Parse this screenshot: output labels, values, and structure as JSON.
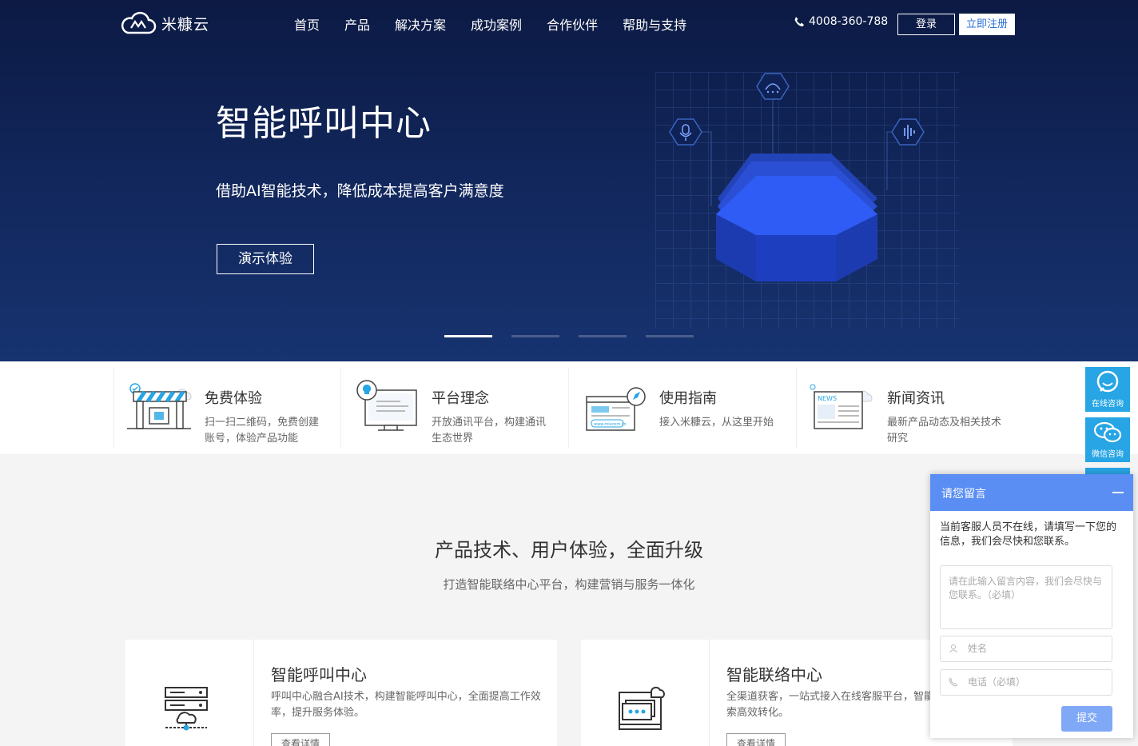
{
  "nav": {
    "logo_text": "米糠云",
    "items": [
      "首页",
      "产品",
      "解决方案",
      "成功案例",
      "合作伙伴",
      "帮助与支持"
    ],
    "phone": "4008-360-788",
    "login": "登录",
    "register": "立即注册"
  },
  "hero": {
    "title": "智能呼叫中心",
    "subtitle": "借助AI智能技术，降低成本提高客户满意度",
    "button": "演示体验",
    "active_slide": 1,
    "slide_count": 4
  },
  "features": [
    {
      "title": "免费体验",
      "desc": "扫一扫二维码，免费创建账号，体验产品功能",
      "icon": "store-icon"
    },
    {
      "title": "平台理念",
      "desc": "开放通讯平台，构建通讯生态世界",
      "icon": "idea-monitor-icon"
    },
    {
      "title": "使用指南",
      "desc": "接入米糠云，从这里开始",
      "icon": "guide-browser-icon",
      "badge": "www.mixcom.cn"
    },
    {
      "title": "新闻资讯",
      "desc": "最新产品动态及相关技术研究",
      "icon": "news-icon",
      "badge": "NEWS"
    }
  ],
  "section": {
    "title": "产品技术、用户体验，全面升级",
    "subtitle": "打造智能联络中心平台，构建营销与服务一体化"
  },
  "cards": [
    {
      "title": "智能呼叫中心",
      "desc": "呼叫中心融合AI技术，构建智能呼叫中心，全面提高工作效率，提升服务体验。",
      "button": "查看详情"
    },
    {
      "title": "智能联络中心",
      "desc": "全渠道获客，一站式接入在线客服平台，智能分配，助力线索高效转化。",
      "button": "查看详情"
    }
  ],
  "float": {
    "online": "在线咨询",
    "wechat": "微信咨询"
  },
  "chat": {
    "header": "请您留言",
    "message": "当前客服人员不在线，请填写一下您的信息，我们会尽快和您联系。",
    "content_placeholder": "请在此输入留言内容，我们会尽快与您联系。（必填）",
    "name_placeholder": "姓名",
    "phone_placeholder": "电话（必填）",
    "submit": "提交"
  },
  "colors": {
    "hero_bg": "#12285e",
    "accent_blue": "#27a5e4",
    "chat_header": "#5b8ef2"
  }
}
